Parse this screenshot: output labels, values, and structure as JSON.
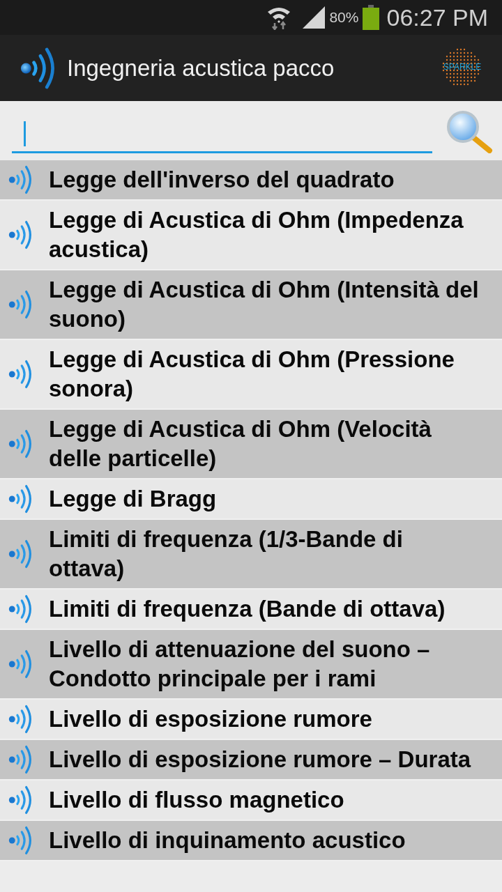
{
  "status_bar": {
    "battery": "80%",
    "time": "06:27 PM"
  },
  "app_bar": {
    "title": "Ingegneria acustica pacco",
    "logo_text": "SPARKLE"
  },
  "items": [
    {
      "label": "Legge dell'inverso del quadrato"
    },
    {
      "label": "Legge di Acustica di Ohm (Impedenza acustica)"
    },
    {
      "label": "Legge di Acustica di Ohm (Intensità del suono)"
    },
    {
      "label": "Legge di Acustica di Ohm (Pressione sonora)"
    },
    {
      "label": "Legge di Acustica di Ohm (Velocità delle particelle)"
    },
    {
      "label": "Legge di Bragg"
    },
    {
      "label": "Limiti di frequenza (1/3-Bande di ottava)"
    },
    {
      "label": "Limiti di frequenza (Bande di ottava)"
    },
    {
      "label": "Livello di attenuazione del suono – Condotto principale per i rami"
    },
    {
      "label": "Livello di esposizione rumore"
    },
    {
      "label": "Livello di esposizione rumore – Durata"
    },
    {
      "label": "Livello di flusso magnetico"
    },
    {
      "label": "Livello di inquinamento acustico"
    }
  ]
}
